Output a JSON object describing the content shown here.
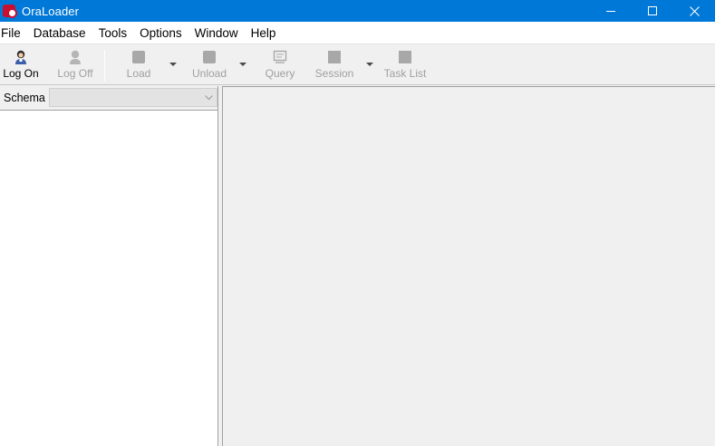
{
  "window": {
    "title": "OraLoader"
  },
  "menu": {
    "items": [
      "File",
      "Database",
      "Tools",
      "Options",
      "Window",
      "Help"
    ]
  },
  "toolbar": {
    "logon_label": "Log On",
    "logoff_label": "Log Off",
    "load_label": "Load",
    "unload_label": "Unload",
    "query_label": "Query",
    "session_label": "Session",
    "tasklist_label": "Task List"
  },
  "schema": {
    "label": "Schema",
    "value": ""
  },
  "icons": {
    "app": "app-icon",
    "minimize": "minimize-icon",
    "maximize": "maximize-icon",
    "close": "close-icon"
  },
  "colors": {
    "titlebar": "#0078d7",
    "disabled_text": "#a0a0a0"
  }
}
